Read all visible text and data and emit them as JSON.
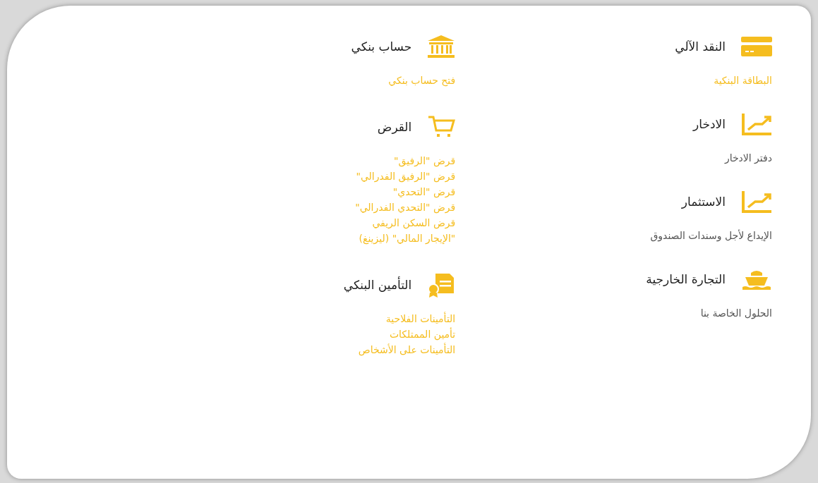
{
  "columns": [
    {
      "sections": [
        {
          "title": "النقد الآلي",
          "links": [
            {
              "label": "البطاقة البنكية",
              "color": "#f5bd1f"
            }
          ]
        },
        {
          "title": "الادخار",
          "links": [
            {
              "label": "دفتر الادخار",
              "color": "#555555"
            }
          ]
        },
        {
          "title": "الاستثمار",
          "links": [
            {
              "label": "الإيداع لأجل وسندات الصندوق",
              "color": "#555555"
            }
          ]
        },
        {
          "title": "التجارة الخارجية",
          "links": [
            {
              "label": "الحلول الخاصة بنا",
              "color": "#555555"
            }
          ]
        }
      ]
    },
    {
      "sections": [
        {
          "title": "حساب بنكي",
          "links": [
            {
              "label": "فتح حساب بنكي",
              "color": "#f5bd1f"
            }
          ]
        },
        {
          "title": "القرض",
          "links": [
            {
              "label": "قرض \"الرفيق\"",
              "color": "#f5bd1f"
            },
            {
              "label": "قرض \"الرفيق الفدرالي\"",
              "color": "#f5bd1f"
            },
            {
              "label": "قرض \"التحدي\"",
              "color": "#f5bd1f"
            },
            {
              "label": "قرض \"التحدي الفدرالي\"",
              "color": "#f5bd1f"
            },
            {
              "label": "قرض السكن الريفي",
              "color": "#f5bd1f"
            },
            {
              "label": "\"الإيجار المالي\" (ليزينغ)",
              "color": "#f5bd1f"
            }
          ]
        },
        {
          "title": "التأمين البنكي",
          "links": [
            {
              "label": "التأمينات الفلاحية",
              "color": "#f5bd1f"
            },
            {
              "label": "تأمين الممتلكات",
              "color": "#f5bd1f"
            },
            {
              "label": "التأمينات على الأشخاص",
              "color": "#f5bd1f"
            }
          ]
        }
      ]
    }
  ]
}
